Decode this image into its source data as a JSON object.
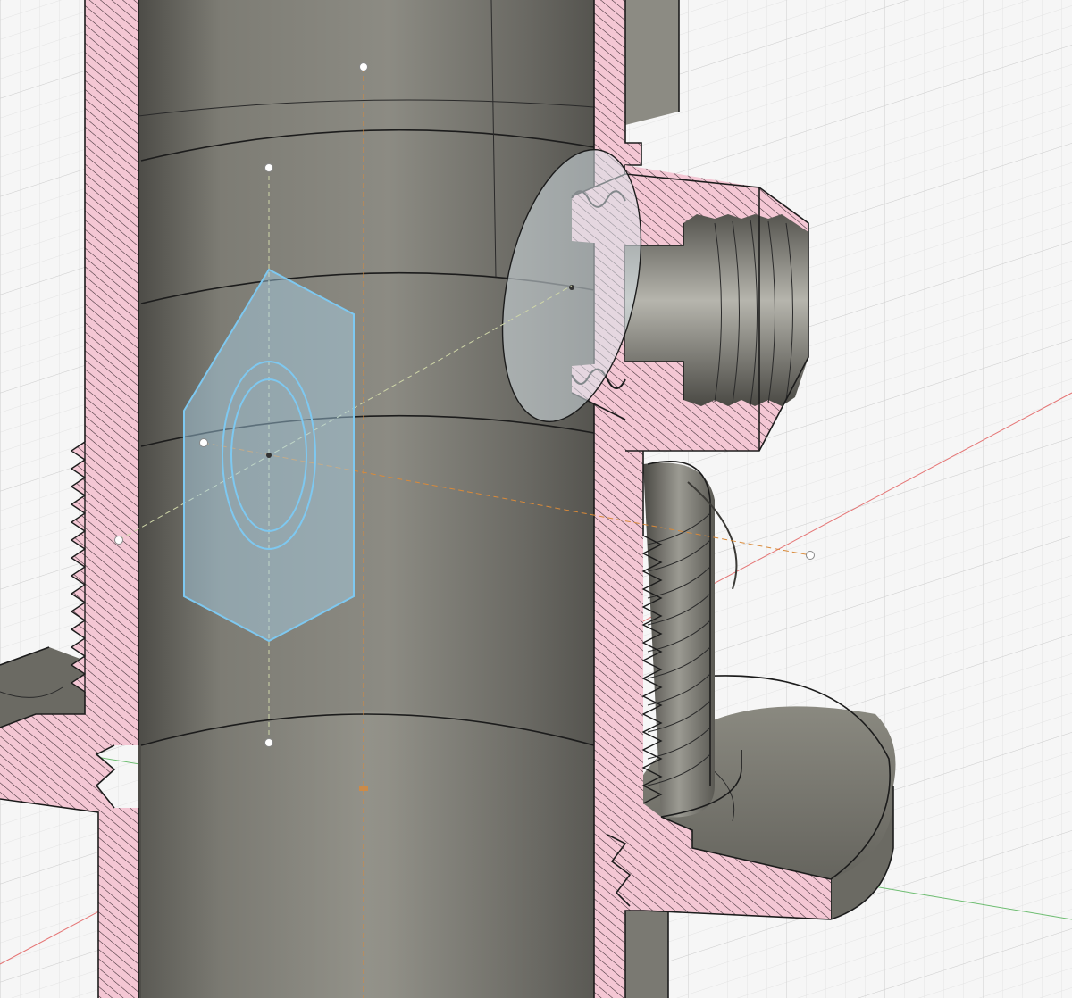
{
  "app": {
    "name": "",
    "view": "section-analysis"
  },
  "colors": {
    "background": "#f6f6f6",
    "grid_minor": "#e4e4e4",
    "grid_major": "#cfcfcf",
    "body_gray": "#7d7c74",
    "body_gray_dark": "#4d4c47",
    "body_gray_light": "#a9a8a0",
    "section_fill": "#f4c7d4",
    "hatch": "#3a2a30",
    "sketch_blue": "#7ec8f0",
    "sketch_fill": "#aad4ee",
    "axis_x": "#e25555",
    "axis_y": "#4caf50",
    "axis_z": "#d98a3a",
    "edge": "#1c1c1c"
  },
  "scene": {
    "objects": [
      {
        "id": "main-pipe",
        "icon": "pipe-body"
      },
      {
        "id": "side-fitting",
        "icon": "threaded-fitting"
      },
      {
        "id": "flange-base",
        "icon": "flange"
      },
      {
        "id": "hex-sketch",
        "icon": "hexagon-sketch"
      },
      {
        "id": "section-plane",
        "icon": "section-plane"
      }
    ]
  }
}
